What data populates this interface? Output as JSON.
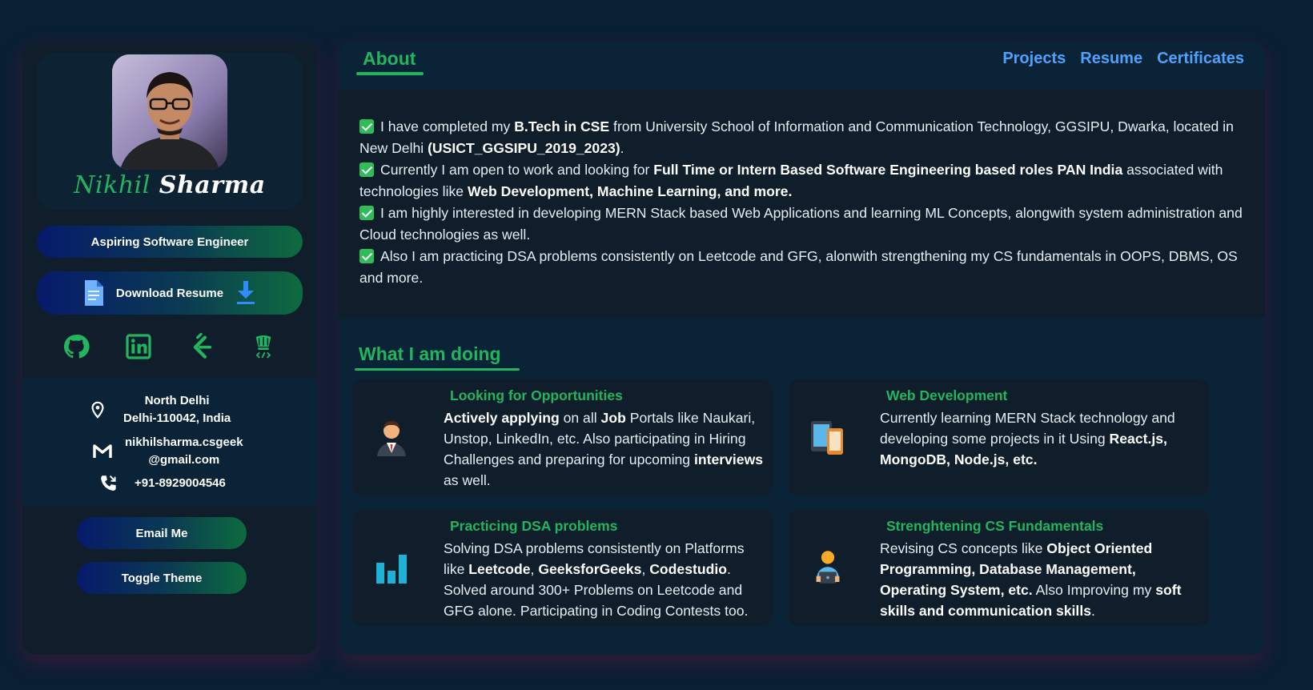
{
  "profile": {
    "first_name": "Nikhil",
    "last_name": "Sharma",
    "tagline": "Aspiring Software Engineer",
    "download_label": "Download Resume"
  },
  "socials": [
    "github-icon",
    "linkedin-icon",
    "leetcode-icon",
    "codestudio-icon"
  ],
  "contact": {
    "location_line1": "North Delhi",
    "location_line2": "Delhi-110042, India",
    "email_line1": "nikhilsharma.csgeek",
    "email_line2": "@gmail.com",
    "phone": "+91-8929004546"
  },
  "buttons": {
    "email": "Email Me",
    "theme": "Toggle Theme"
  },
  "nav": {
    "active_tab": "About",
    "links": [
      "Projects",
      "Resume",
      "Certificates"
    ]
  },
  "about": [
    {
      "parts": [
        {
          "t": "I have completed my ",
          "b": false
        },
        {
          "t": "B.Tech in CSE",
          "b": true
        },
        {
          "t": " from University School of Information and Communication Technology, GGSIPU, Dwarka, located in New Delhi ",
          "b": false
        },
        {
          "t": "(USICT_GGSIPU_2019_2023)",
          "b": true
        },
        {
          "t": ".",
          "b": false
        }
      ]
    },
    {
      "parts": [
        {
          "t": "Currently I am open to work and looking for ",
          "b": false
        },
        {
          "t": "Full Time or Intern Based Software Engineering based roles PAN India",
          "b": true
        },
        {
          "t": " associated with technologies like ",
          "b": false
        },
        {
          "t": "Web Development, Machine Learning, and more.",
          "b": true
        }
      ]
    },
    {
      "parts": [
        {
          "t": "I am highly interested in developing MERN Stack based Web Applications and learning ML Concepts, alongwith system administration and Cloud technologies as well.",
          "b": false
        }
      ]
    },
    {
      "parts": [
        {
          "t": "Also I am practicing DSA problems consistently on Leetcode and GFG, alonwith strengthening my CS fundamentals in OOPS, DBMS, OS and more.",
          "b": false
        }
      ]
    }
  ],
  "doing": {
    "title": "What I am doing",
    "cards": [
      {
        "icon": "businessman-icon",
        "title": "Looking for Opportunities",
        "parts": [
          {
            "t": "Actively applying",
            "b": true
          },
          {
            "t": " on all ",
            "b": false
          },
          {
            "t": "Job",
            "b": true
          },
          {
            "t": " Portals like Naukari, Unstop, LinkedIn, etc. Also participating in Hiring Challenges and preparing for upcoming ",
            "b": false
          },
          {
            "t": "interviews",
            "b": true
          },
          {
            "t": " as well.",
            "b": false
          }
        ]
      },
      {
        "icon": "devices-icon",
        "title": "Web Development",
        "parts": [
          {
            "t": "Currently learning MERN Stack technology and developing some projects in it Using ",
            "b": false
          },
          {
            "t": "React.js, MongoDB, Node.js, etc.",
            "b": true
          }
        ]
      },
      {
        "icon": "bar-chart-icon",
        "title": "Practicing DSA problems",
        "parts": [
          {
            "t": "Solving DSA problems consistently on Platforms like ",
            "b": false
          },
          {
            "t": "Leetcode",
            "b": true
          },
          {
            "t": ", ",
            "b": false
          },
          {
            "t": "GeeksforGeeks",
            "b": true
          },
          {
            "t": ", ",
            "b": false
          },
          {
            "t": "Codestudio",
            "b": true
          },
          {
            "t": ". Solved around 300+ Problems on Leetcode and GFG alone. Participating in Coding Contests too.",
            "b": false
          }
        ]
      },
      {
        "icon": "person-laptop-icon",
        "title": "Strenghtening CS Fundamentals",
        "parts": [
          {
            "t": "Revising CS concepts like ",
            "b": false
          },
          {
            "t": "Object Oriented Programming, Database Management, Operating System, etc.",
            "b": true
          },
          {
            "t": " Also Improving my ",
            "b": false
          },
          {
            "t": "soft skills and communication skills",
            "b": true
          },
          {
            "t": ".",
            "b": false
          }
        ]
      }
    ]
  },
  "colors": {
    "accent_green": "#22b45e",
    "link_blue": "#4ea2ff",
    "page_bg": "#0b1f33",
    "panel_bg": "#101e2b"
  }
}
